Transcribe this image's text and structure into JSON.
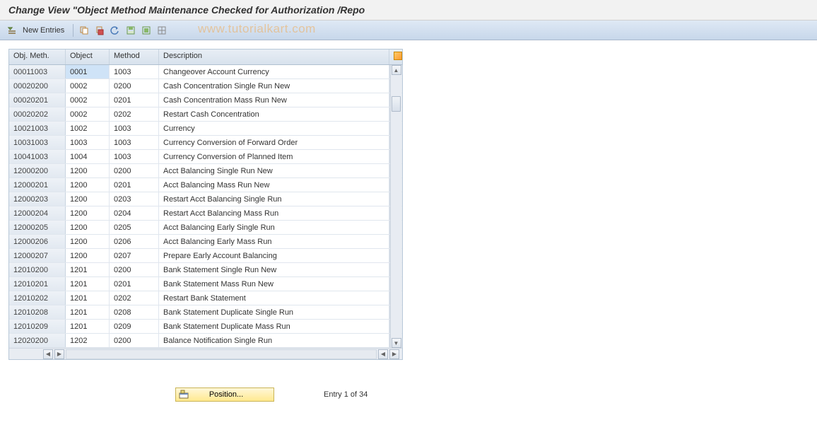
{
  "title": "Change View \"Object Method Maintenance Checked for Authorization /Repo",
  "watermark": "www.tutorialkart.com",
  "toolbar": {
    "new_entries": "New Entries"
  },
  "table": {
    "headers": {
      "obj_meth": "Obj. Meth.",
      "object": "Object",
      "method": "Method",
      "description": "Description"
    },
    "rows": [
      {
        "om": "00011003",
        "ob": "0001",
        "me": "1003",
        "de": "Changeover Account Currency",
        "sel": true
      },
      {
        "om": "00020200",
        "ob": "0002",
        "me": "0200",
        "de": "Cash Concentration Single Run New"
      },
      {
        "om": "00020201",
        "ob": "0002",
        "me": "0201",
        "de": "Cash Concentration Mass Run New"
      },
      {
        "om": "00020202",
        "ob": "0002",
        "me": "0202",
        "de": "Restart Cash Concentration"
      },
      {
        "om": "10021003",
        "ob": "1002",
        "me": "1003",
        "de": "Currency"
      },
      {
        "om": "10031003",
        "ob": "1003",
        "me": "1003",
        "de": "Currency Conversion of Forward Order"
      },
      {
        "om": "10041003",
        "ob": "1004",
        "me": "1003",
        "de": "Currency Conversion of Planned Item"
      },
      {
        "om": "12000200",
        "ob": "1200",
        "me": "0200",
        "de": "Acct Balancing Single Run New"
      },
      {
        "om": "12000201",
        "ob": "1200",
        "me": "0201",
        "de": "Acct Balancing Mass Run New"
      },
      {
        "om": "12000203",
        "ob": "1200",
        "me": "0203",
        "de": "Restart Acct Balancing Single Run"
      },
      {
        "om": "12000204",
        "ob": "1200",
        "me": "0204",
        "de": "Restart Acct Balancing Mass Run"
      },
      {
        "om": "12000205",
        "ob": "1200",
        "me": "0205",
        "de": "Acct Balancing Early Single Run"
      },
      {
        "om": "12000206",
        "ob": "1200",
        "me": "0206",
        "de": "Acct Balancing Early Mass Run"
      },
      {
        "om": "12000207",
        "ob": "1200",
        "me": "0207",
        "de": "Prepare Early Account Balancing"
      },
      {
        "om": "12010200",
        "ob": "1201",
        "me": "0200",
        "de": "Bank Statement Single Run New"
      },
      {
        "om": "12010201",
        "ob": "1201",
        "me": "0201",
        "de": "Bank Statement Mass Run New"
      },
      {
        "om": "12010202",
        "ob": "1201",
        "me": "0202",
        "de": "Restart Bank Statement"
      },
      {
        "om": "12010208",
        "ob": "1201",
        "me": "0208",
        "de": "Bank Statement Duplicate Single Run"
      },
      {
        "om": "12010209",
        "ob": "1201",
        "me": "0209",
        "de": "Bank Statement Duplicate Mass Run"
      },
      {
        "om": "12020200",
        "ob": "1202",
        "me": "0200",
        "de": "Balance Notification Single Run"
      }
    ]
  },
  "footer": {
    "position_label": "Position...",
    "entry_text": "Entry 1 of 34"
  }
}
